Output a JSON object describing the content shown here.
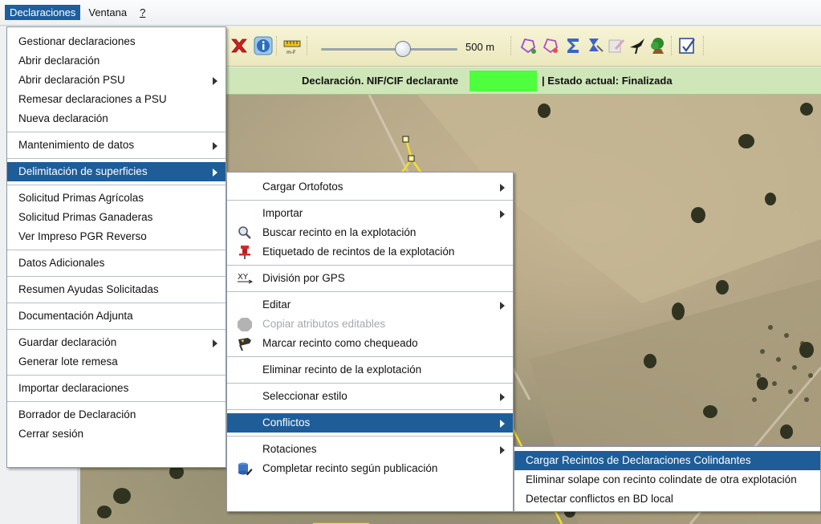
{
  "menubar": {
    "items": [
      "Declaraciones",
      "Ventana",
      "?"
    ]
  },
  "toolbar": {
    "scale_value": "500 m"
  },
  "status": {
    "label": "Declaración. NIF/CIF declarante",
    "estado": "| Estado actual: Finalizada"
  },
  "menu_declaraciones": {
    "items": [
      "Gestionar declaraciones",
      "Abrir declaración",
      "Abrir declaración PSU",
      "Remesar declaraciones a PSU",
      "Nueva declaración",
      "Mantenimiento de datos",
      "Delimitación de superficies",
      "Solicitud Primas Agrícolas",
      "Solicitud Primas Ganaderas",
      "Ver Impreso PGR Reverso",
      "Datos Adicionales",
      "Resumen Ayudas Solicitadas",
      "Documentación Adjunta",
      "Guardar declaración",
      "Generar lote remesa",
      "Importar declaraciones",
      "Borrador de Declaración",
      "Cerrar sesión"
    ]
  },
  "menu_delimitacion": {
    "items": [
      "Cargar Ortofotos",
      "Importar",
      "Buscar recinto en la explotación",
      "Etiquetado de recintos de la explotación",
      "División por GPS",
      "Editar",
      "Copiar atributos editables",
      "Marcar recinto como chequeado",
      "Eliminar recinto de la explotación",
      "Seleccionar estilo",
      "Conflictos",
      "Rotaciones",
      "Completar recinto según publicación"
    ]
  },
  "menu_conflictos": {
    "items": [
      "Cargar Recintos de Declaraciones Colindantes",
      "Eliminar solape con recinto colindate de otra explotación",
      "Detectar conflictos en BD local"
    ]
  },
  "colors": {
    "selection": "#1f5d99",
    "status_band": "#cfe6b8",
    "nif_highlight": "#4dff3c",
    "toolbar": "#f1eec9"
  }
}
